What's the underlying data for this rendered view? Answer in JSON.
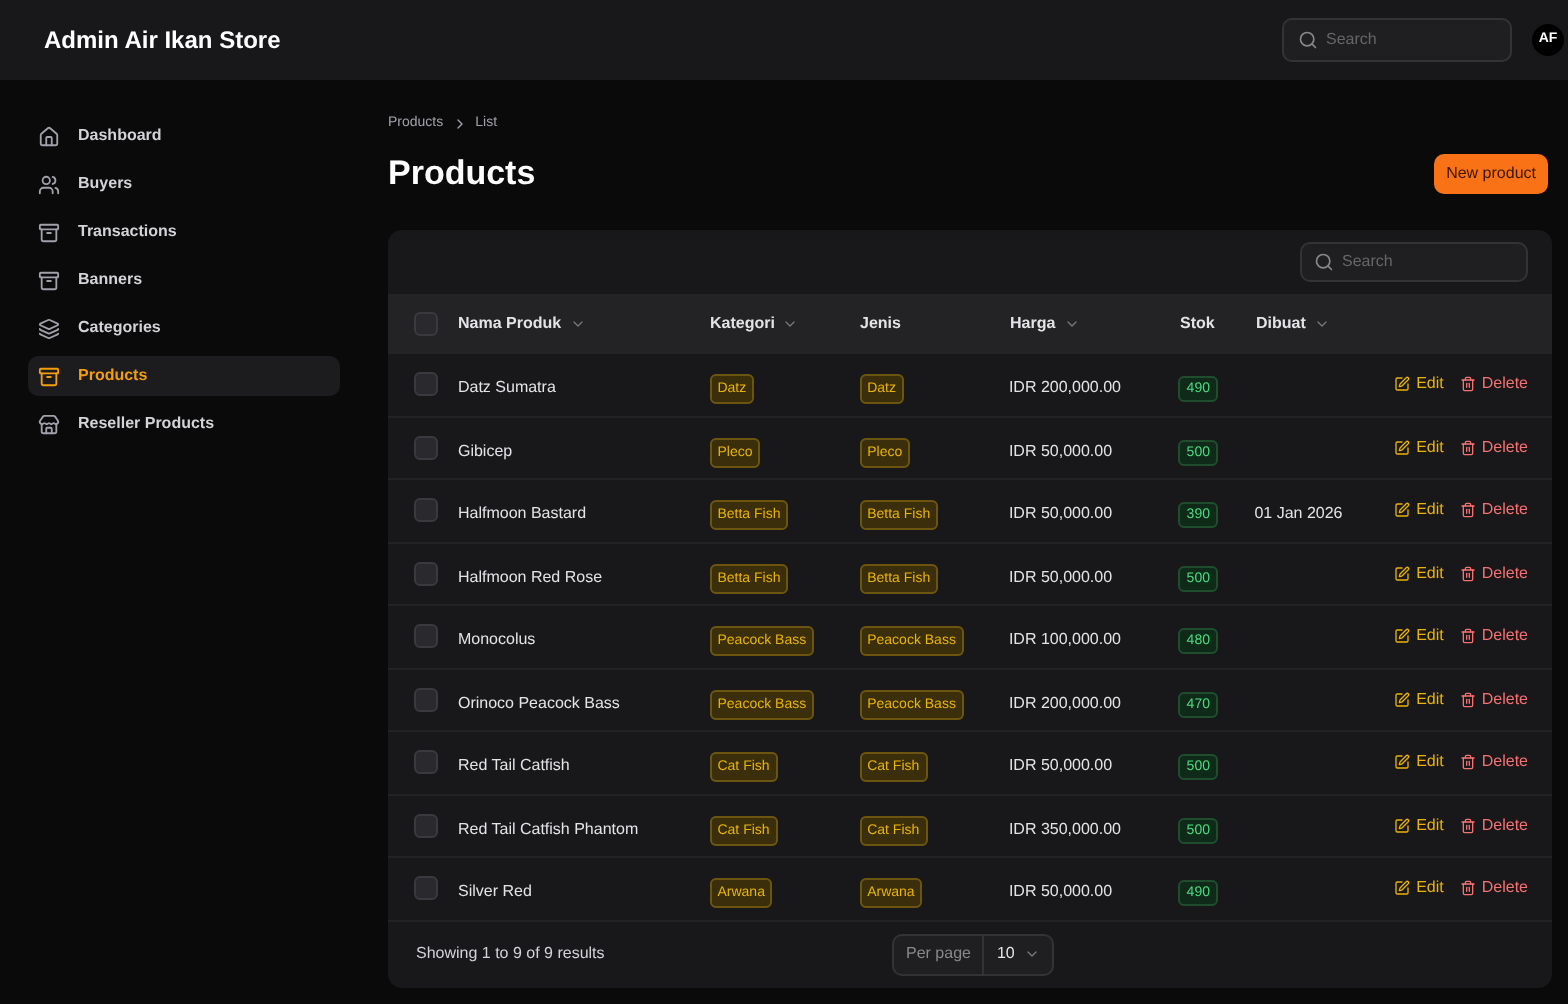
{
  "topbar": {
    "title": "Admin Air Ikan Store",
    "search": {
      "placeholder": "Search"
    },
    "avatar": "AF"
  },
  "sidebar": {
    "items": [
      {
        "label": "Dashboard",
        "selected": false
      },
      {
        "label": "Buyers",
        "selected": false
      },
      {
        "label": "Transactions",
        "selected": false
      },
      {
        "label": "Banners",
        "selected": false
      },
      {
        "label": "Categories",
        "selected": false
      },
      {
        "label": "Products",
        "selected": true
      },
      {
        "label": "Reseller Products",
        "selected": false
      }
    ]
  },
  "breadcrumbs": [
    "Products",
    "List"
  ],
  "page_title": "Products",
  "new_button": "New product",
  "table": {
    "search": {
      "placeholder": "Search"
    },
    "select_all": {
      "checked": false
    },
    "columns": [
      {
        "label": "Nama Produk",
        "sortable": true
      },
      {
        "label": "Kategori",
        "sortable": true
      },
      {
        "label": "Jenis",
        "sortable": false
      },
      {
        "label": "Harga",
        "sortable": true
      },
      {
        "label": "Stok",
        "sortable": false
      },
      {
        "label": "Dibuat",
        "sortable": true
      }
    ],
    "rows": [
      {
        "checked": false,
        "name": "Datz Sumatra",
        "kategori": "Datz",
        "jenis": "Datz",
        "harga": "IDR 200,000.00",
        "stok": "490",
        "dibuat": "",
        "edit": "Edit",
        "delete": "Delete"
      },
      {
        "checked": false,
        "name": "Gibicep",
        "kategori": "Pleco",
        "jenis": "Pleco",
        "harga": "IDR 50,000.00",
        "stok": "500",
        "dibuat": "",
        "edit": "Edit",
        "delete": "Delete"
      },
      {
        "checked": false,
        "name": "Halfmoon Bastard",
        "kategori": "Betta Fish",
        "jenis": "Betta Fish",
        "harga": "IDR 50,000.00",
        "stok": "390",
        "dibuat": "01 Jan 2026",
        "edit": "Edit",
        "delete": "Delete"
      },
      {
        "checked": false,
        "name": "Halfmoon Red Rose",
        "kategori": "Betta Fish",
        "jenis": "Betta Fish",
        "harga": "IDR 50,000.00",
        "stok": "500",
        "dibuat": "",
        "edit": "Edit",
        "delete": "Delete"
      },
      {
        "checked": false,
        "name": "Monocolus",
        "kategori": "Peacock Bass",
        "jenis": "Peacock Bass",
        "harga": "IDR 100,000.00",
        "stok": "480",
        "dibuat": "",
        "edit": "Edit",
        "delete": "Delete"
      },
      {
        "checked": false,
        "name": "Orinoco Peacock Bass",
        "kategori": "Peacock Bass",
        "jenis": "Peacock Bass",
        "harga": "IDR 200,000.00",
        "stok": "470",
        "dibuat": "",
        "edit": "Edit",
        "delete": "Delete"
      },
      {
        "checked": false,
        "name": "Red Tail Catfish",
        "kategori": "Cat Fish",
        "jenis": "Cat Fish",
        "harga": "IDR 50,000.00",
        "stok": "500",
        "dibuat": "",
        "edit": "Edit",
        "delete": "Delete"
      },
      {
        "checked": false,
        "name": "Red Tail Catfish Phantom",
        "kategori": "Cat Fish",
        "jenis": "Cat Fish",
        "harga": "IDR 350,000.00",
        "stok": "500",
        "dibuat": "",
        "edit": "Edit",
        "delete": "Delete"
      },
      {
        "checked": false,
        "name": "Silver Red",
        "kategori": "Arwana",
        "jenis": "Arwana",
        "harga": "IDR 50,000.00",
        "stok": "490",
        "dibuat": "",
        "edit": "Edit",
        "delete": "Delete"
      }
    ],
    "summary": "Showing 1 to 9 of 9 results",
    "per_page": {
      "label": "Per page",
      "value": "10"
    }
  }
}
